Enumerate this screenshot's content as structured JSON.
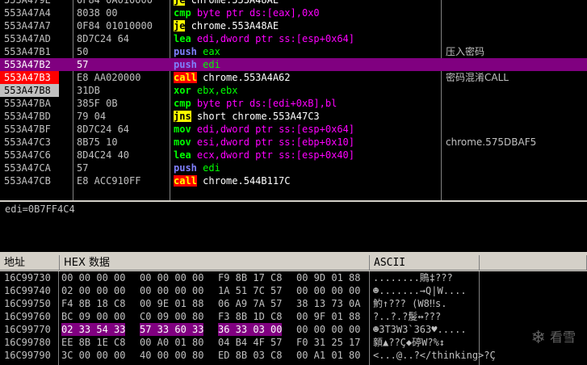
{
  "disasm": {
    "rows": [
      {
        "addr": "553A479E",
        "hex": "0F84 0A010000",
        "mn": "je",
        "ops": "chrome.553A48AE",
        "comment": ""
      },
      {
        "addr": "553A47A4",
        "hex": "8038 00",
        "mn": "cmp",
        "ops": "byte ptr ds:[eax],0x0",
        "comment": ""
      },
      {
        "addr": "553A47A7",
        "hex": "0F84 01010000",
        "mn": "je",
        "ops": "chrome.553A48AE",
        "comment": ""
      },
      {
        "addr": "553A47AD",
        "hex": "8D7C24 64",
        "mn": "lea",
        "ops": "edi,dword ptr ss:[esp+0x64]",
        "comment": ""
      },
      {
        "addr": "553A47B1",
        "hex": "50",
        "mn": "push",
        "ops": "eax",
        "comment": "压入密码"
      },
      {
        "addr": "553A47B2",
        "hex": "57",
        "mn": "push",
        "ops": "edi",
        "comment": ""
      },
      {
        "addr": "553A47B3",
        "hex": "E8 AA020000",
        "mn": "call",
        "ops": "chrome.553A4A62",
        "comment": "密码混淆CALL"
      },
      {
        "addr": "553A47B8",
        "hex": "31DB",
        "mn": "xor",
        "ops": "ebx,ebx",
        "comment": ""
      },
      {
        "addr": "553A47BA",
        "hex": "385F 0B",
        "mn": "cmp",
        "ops": "byte ptr ds:[edi+0xB],bl",
        "comment": ""
      },
      {
        "addr": "553A47BD",
        "hex": "79 04",
        "mn": "jns",
        "ops": "short chrome.553A47C3",
        "comment": ""
      },
      {
        "addr": "553A47BF",
        "hex": "8D7C24 64",
        "mn": "mov",
        "ops": "edi,dword ptr ss:[esp+0x64]",
        "comment": ""
      },
      {
        "addr": "553A47C3",
        "hex": "8B75 10",
        "mn": "mov",
        "ops": "esi,dword ptr ss:[ebp+0x10]",
        "comment": "chrome.575DBAF5"
      },
      {
        "addr": "553A47C6",
        "hex": "8D4C24 40",
        "mn": "lea",
        "ops": "ecx,dword ptr ss:[esp+0x40]",
        "comment": ""
      },
      {
        "addr": "553A47CA",
        "hex": "57",
        "mn": "push",
        "ops": "edi",
        "comment": ""
      },
      {
        "addr": "553A47CB",
        "hex": "E8 ACC910FF",
        "mn": "call",
        "ops": "chrome.544B117C",
        "comment": ""
      }
    ]
  },
  "info": {
    "text": "edi=0B7FF4C4"
  },
  "dump": {
    "headers": {
      "address": "地址",
      "hex": "HEX 数据",
      "ascii": "ASCII"
    },
    "rows": [
      {
        "addr": "16C99730",
        "g1": "00 00 00 00",
        "g2": "00 00 00 00",
        "g3": "F9 8B 17 C8",
        "g4": "00 9D 01 88",
        "ascii": "........鵙‡???"
      },
      {
        "addr": "16C99740",
        "g1": "02 00 00 00",
        "g2": "00 00 00 00",
        "g3": "1A 51 7C 57",
        "g4": "00 00 00 00",
        "ascii": "☻.......→Q|W...."
      },
      {
        "addr": "16C99750",
        "g1": "F4 8B 18 C8",
        "g2": "00 9E 01 88",
        "g3": "06 A9 7A 57",
        "g4": "38 13 73 0A",
        "ascii": "魡↑??? (W8‼s."
      },
      {
        "addr": "16C99760",
        "g1": "BC 09 00 00",
        "g2": "C0 09 00 80",
        "g3": "F3 8B 1D C8",
        "g4": "00 9F 01 88",
        "ascii": "?..?.?髲↔???"
      },
      {
        "addr": "16C99770",
        "g1": "02 33 54 33",
        "g2": "57 33 60 33",
        "g3": "36 33 03 00",
        "g4": "00 00 00 00",
        "ascii": "☻3T3W3`363♥....."
      },
      {
        "addr": "16C99780",
        "g1": "EE 8B 1E C8",
        "g2": "00 A0 01 80",
        "g3": "04 B4 4F 57",
        "g4": "F0 31 25 17",
        "ascii": "顡▲??Ç◆碠W?%↕"
      },
      {
        "addr": "16C99790",
        "g1": "3C 00 00 00",
        "g2": "40 00 00 80",
        "g3": "ED 8B 03 C8",
        "g4": "00 A1 01 80",
        "ascii": "<...@..?</thinking>?Ç"
      }
    ]
  },
  "watermark": {
    "text": "看雪"
  }
}
